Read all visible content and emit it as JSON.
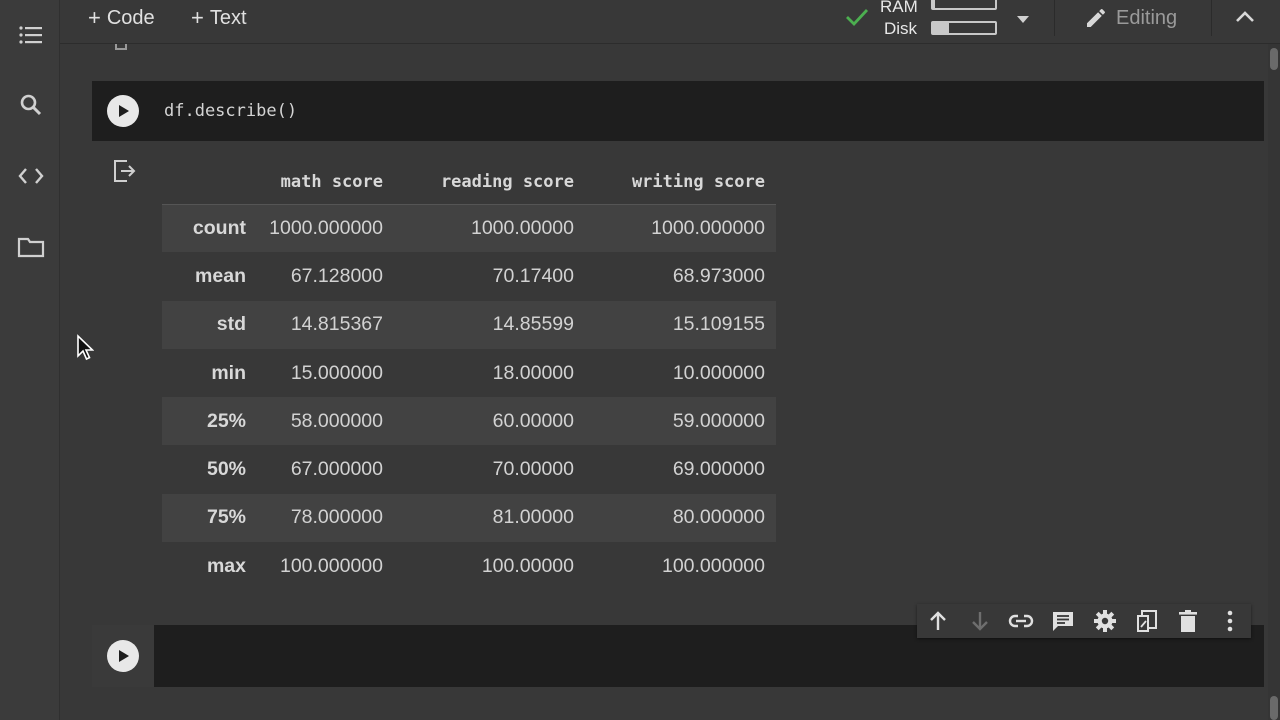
{
  "toolbar": {
    "code_label": "Code",
    "text_label": "Text",
    "editing_label": "Editing"
  },
  "resources": {
    "ram_label": "RAM",
    "disk_label": "Disk",
    "ram_fraction": 0.03,
    "disk_fraction": 0.25
  },
  "sidebar": {
    "icons": [
      "menu-icon",
      "search-icon",
      "code-icon",
      "folder-icon"
    ]
  },
  "cell1": {
    "code": "df.describe()"
  },
  "describe_table": {
    "columns": [
      "math score",
      "reading score",
      "writing score"
    ],
    "rows": [
      {
        "label": "count",
        "values": [
          "1000.000000",
          "1000.00000",
          "1000.000000"
        ]
      },
      {
        "label": "mean",
        "values": [
          "67.128000",
          "70.17400",
          "68.973000"
        ]
      },
      {
        "label": "std",
        "values": [
          "14.815367",
          "14.85599",
          "15.109155"
        ]
      },
      {
        "label": "min",
        "values": [
          "15.000000",
          "18.00000",
          "10.000000"
        ]
      },
      {
        "label": "25%",
        "values": [
          "58.000000",
          "60.00000",
          "59.000000"
        ]
      },
      {
        "label": "50%",
        "values": [
          "67.000000",
          "70.00000",
          "69.000000"
        ]
      },
      {
        "label": "75%",
        "values": [
          "78.000000",
          "81.00000",
          "80.000000"
        ]
      },
      {
        "label": "max",
        "values": [
          "100.000000",
          "100.00000",
          "100.000000"
        ]
      }
    ]
  },
  "cell_tools": [
    "move-up-icon",
    "move-down-icon",
    "link-icon",
    "comment-icon",
    "settings-icon",
    "mirror-icon",
    "delete-icon",
    "more-icon"
  ],
  "colors": {
    "background": "#383838",
    "cell_bg": "#1e1e1e",
    "check": "#4caf50"
  }
}
